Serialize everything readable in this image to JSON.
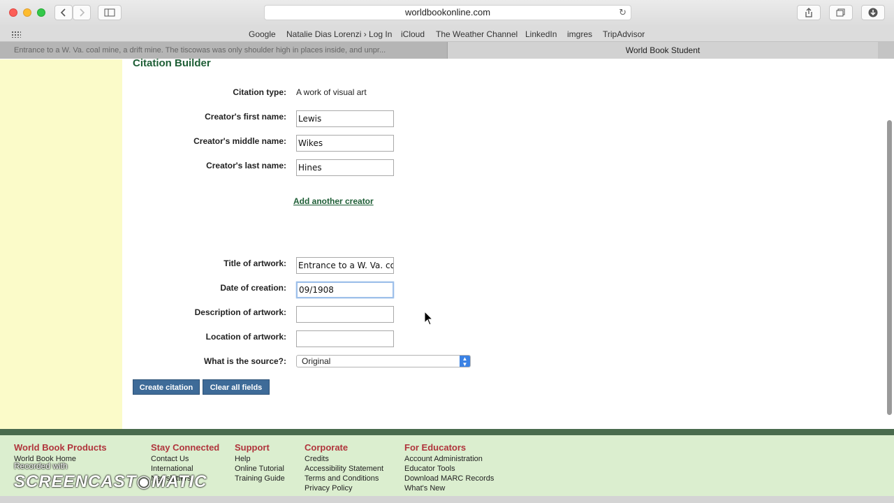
{
  "browser": {
    "url": "worldbookonline.com",
    "bookmarks": [
      "Google",
      "Natalie Dias Lorenzi › Log In",
      "iCloud",
      "The Weather Channel",
      "LinkedIn",
      "imgres",
      "TripAdvisor"
    ],
    "tabs": [
      {
        "title": "Entrance to a W. Va. coal mine, a drift mine. The tiscowas was only shoulder high in places inside, and unpr..."
      },
      {
        "title": "World Book Student"
      }
    ]
  },
  "page": {
    "heading": "Citation Builder",
    "citation_type_label": "Citation type:",
    "citation_type_value": "A work of visual art",
    "first_name_label": "Creator's first name:",
    "first_name_value": "Lewis",
    "middle_name_label": "Creator's middle name:",
    "middle_name_value": "Wikes",
    "last_name_label": "Creator's last name:",
    "last_name_value": "Hines",
    "add_creator_link": "Add another creator",
    "title_label": "Title of artwork:",
    "title_value": "Entrance to a W. Va. coa",
    "date_label": "Date of creation:",
    "date_value": "09/1908",
    "description_label": "Description of artwork:",
    "description_value": "",
    "location_label": "Location of artwork:",
    "location_value": "",
    "source_label": "What is the source?:",
    "source_value": "Original",
    "create_button": "Create citation",
    "clear_button": "Clear all fields"
  },
  "footer": {
    "columns": [
      {
        "heading": "World Book Products",
        "links": [
          "World Book Home"
        ]
      },
      {
        "heading": "Stay Connected",
        "links": [
          "Contact Us",
          "International",
          "Newsletters"
        ]
      },
      {
        "heading": "Support",
        "links": [
          "Help",
          "Online Tutorial",
          "Training Guide"
        ]
      },
      {
        "heading": "Corporate",
        "links": [
          "Credits",
          "Accessibility Statement",
          "Terms and Conditions",
          "Privacy Policy"
        ]
      },
      {
        "heading": "For Educators",
        "links": [
          "Account Administration",
          "Educator Tools",
          "Download MARC Records",
          "What's New"
        ]
      }
    ]
  },
  "watermark": {
    "line1": "Recorded with",
    "line2": "SCREENCAST◉MATIC"
  },
  "colors": {
    "heading": "#1e5e36",
    "sidebar": "#fbfbc9",
    "footer_bg": "#dbeecf",
    "footer_heading": "#b0343c",
    "button": "#3e6b98"
  }
}
